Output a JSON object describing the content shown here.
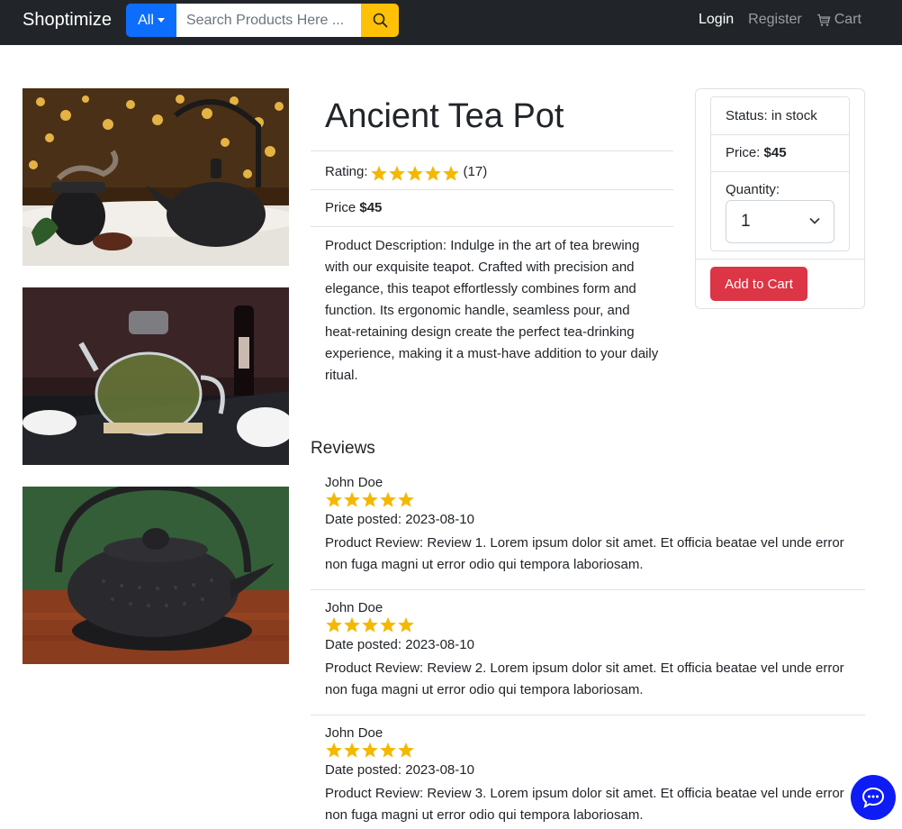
{
  "navbar": {
    "brand": "Shoptimize",
    "category_label": "All",
    "search_placeholder": "Search Products Here ...",
    "login": "Login",
    "register": "Register",
    "cart": "Cart"
  },
  "product": {
    "title": "Ancient Tea Pot",
    "rating_label": "Rating:",
    "rating": 5,
    "review_count": "(17)",
    "price_label": "Price",
    "price": "$45",
    "description": "Product Description: Indulge in the art of tea brewing with our exquisite teapot. Crafted with precision and elegance, this teapot effortlessly combines form and function. Its ergonomic handle, seamless pour, and heat-retaining design create the perfect tea-drinking experience, making it a must-have addition to your daily ritual."
  },
  "buy_box": {
    "status": "Status: in stock",
    "price_label": "Price:",
    "price": "$45",
    "quantity_label": "Quantity:",
    "quantity": "1",
    "add_to_cart": "Add to Cart"
  },
  "reviews": {
    "heading": "Reviews",
    "items": [
      {
        "name": "John Doe",
        "rating": 5,
        "date": "Date posted: 2023-08-10",
        "text": "Product Review: Review 1. Lorem ipsum dolor sit amet. Et officia beatae vel unde error non fuga magni ut error odio qui tempora laboriosam."
      },
      {
        "name": "John Doe",
        "rating": 5,
        "date": "Date posted: 2023-08-10",
        "text": "Product Review: Review 2. Lorem ipsum dolor sit amet. Et officia beatae vel unde error non fuga magni ut error odio qui tempora laboriosam."
      },
      {
        "name": "John Doe",
        "rating": 5,
        "date": "Date posted: 2023-08-10",
        "text": "Product Review: Review 3. Lorem ipsum dolor sit amet. Et officia beatae vel unde error non fuga magni ut error odio qui tempora laboriosam."
      }
    ]
  },
  "icons": {
    "search": "search-icon",
    "cart": "cart-icon",
    "star": "star-icon",
    "chevron": "chevron-down-icon",
    "chat": "chat-icon"
  },
  "colors": {
    "navbar": "#212529",
    "primary": "#0d6efd",
    "warning": "#ffc107",
    "danger": "#dc3545",
    "star": "#f5b800",
    "chat": "#0d1cf5"
  }
}
